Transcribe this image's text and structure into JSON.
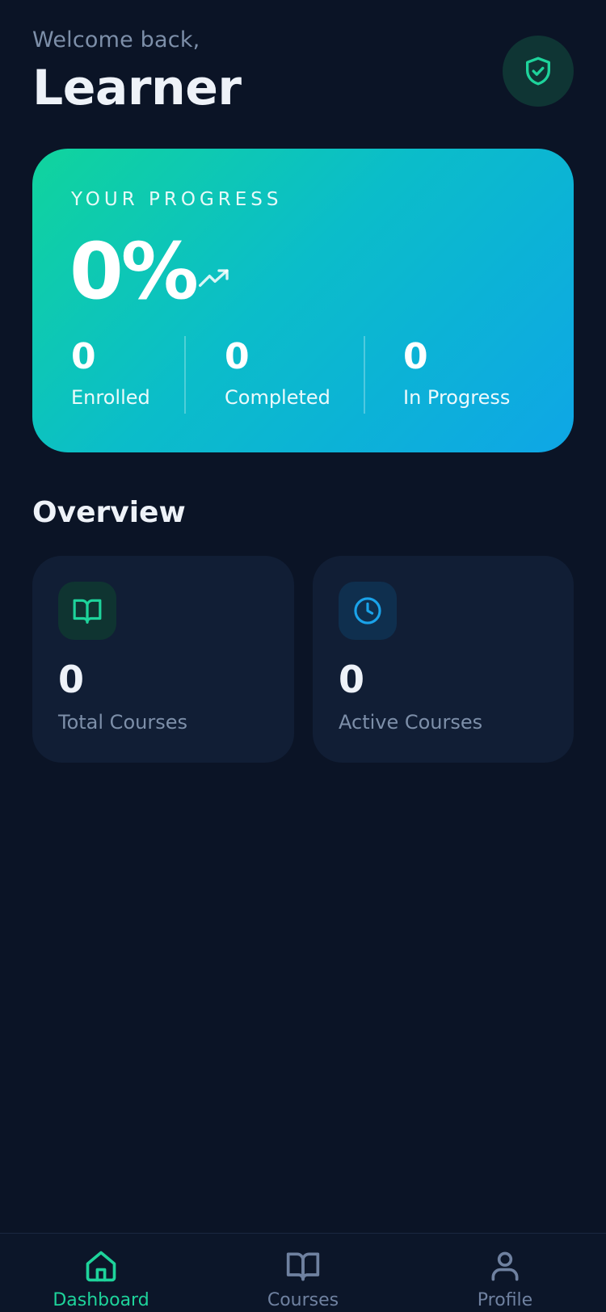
{
  "header": {
    "greeting": "Welcome back,",
    "user_name": "Learner",
    "badge_icon": "shield-check-icon"
  },
  "progress": {
    "title": "YOUR PROGRESS",
    "percent": "0%",
    "trend_icon": "trending-up-icon",
    "stats": [
      {
        "value": "0",
        "label": "Enrolled"
      },
      {
        "value": "0",
        "label": "Completed"
      },
      {
        "value": "0",
        "label": "In Progress"
      }
    ]
  },
  "overview": {
    "title": "Overview",
    "cards": [
      {
        "icon": "book-open-icon",
        "value": "0",
        "label": "Total Courses"
      },
      {
        "icon": "clock-icon",
        "value": "0",
        "label": "Active Courses"
      }
    ]
  },
  "nav": {
    "items": [
      {
        "icon": "home-icon",
        "label": "Dashboard",
        "active": true
      },
      {
        "icon": "book-open-icon",
        "label": "Courses",
        "active": false
      },
      {
        "icon": "user-icon",
        "label": "Profile",
        "active": false
      }
    ]
  },
  "colors": {
    "background": "#0b1426",
    "card": "#111e35",
    "accent_green": "#10d49d",
    "accent_blue": "#0ea6e6",
    "muted_text": "#7d8fa9"
  }
}
